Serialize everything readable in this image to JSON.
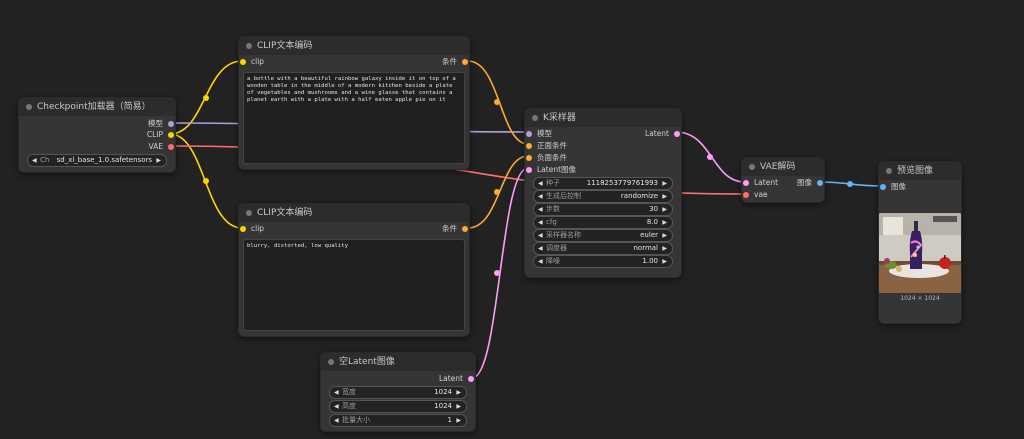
{
  "colors": {
    "clip": "#ffd500",
    "model": "#b39ddb",
    "vae": "#ff6e6e",
    "conditioning": "#ffa931",
    "latent": "#ff9cf9",
    "image": "#64b5f6",
    "widget_bg": "#232323"
  },
  "checkpoint": {
    "title": "Checkpoint加载器（简易）",
    "outputs": [
      "模型",
      "CLIP",
      "VAE"
    ],
    "ckpt_label": "Ch",
    "ckpt_value": "sd_xl_base_1.0.safetensors"
  },
  "clip_pos": {
    "title": "CLIP文本编码",
    "input": "clip",
    "output": "条件",
    "text": "a bottle with a beautiful rainbow galaxy inside it on top of a wooden table in the middle of a modern kitchen beside a plate of vegetables and mushrooms and a wine glasse that contains a planet earth with a plate with a half eaten apple pie on it"
  },
  "clip_neg": {
    "title": "CLIP文本编码",
    "input": "clip",
    "output": "条件",
    "text": "blurry, distorted, low quality"
  },
  "empty_latent": {
    "title": "空Latent图像",
    "output": "Latent",
    "widgets": [
      {
        "label": "宽度",
        "value": "1024"
      },
      {
        "label": "高度",
        "value": "1024"
      },
      {
        "label": "批量大小",
        "value": "1"
      }
    ]
  },
  "ksampler": {
    "title": "K采样器",
    "inputs": [
      "模型",
      "正面条件",
      "负面条件",
      "Latent图像"
    ],
    "output": "Latent",
    "widgets": [
      {
        "label": "种子",
        "value": "1118253779761993"
      },
      {
        "label": "生成后控制",
        "value": "randomize"
      },
      {
        "label": "步数",
        "value": "30"
      },
      {
        "label": "cfg",
        "value": "8.0"
      },
      {
        "label": "采样器名称",
        "value": "euler"
      },
      {
        "label": "调度器",
        "value": "normal"
      },
      {
        "label": "降噪",
        "value": "1.00"
      }
    ]
  },
  "vae_decode": {
    "title": "VAE解码",
    "inputs": [
      "Latent",
      "vae"
    ],
    "output": "图像"
  },
  "preview": {
    "title": "预览图像",
    "input": "图像",
    "size_label": "1024 × 1024"
  }
}
